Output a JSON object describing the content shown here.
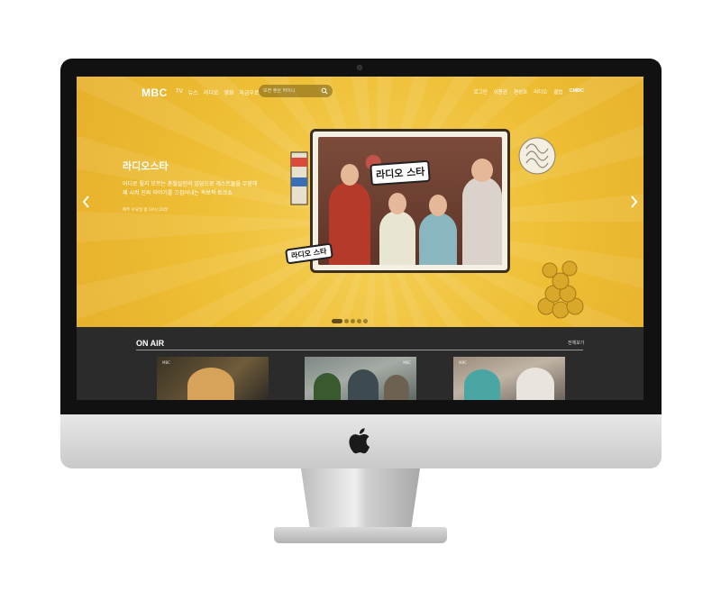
{
  "header": {
    "logo": "MBC",
    "nav": [
      "TV",
      "뉴스",
      "라디오",
      "영화",
      "자금우로"
    ],
    "search_placeholder": "보면 좋은 하이니",
    "util": [
      "로그인",
      "이용권",
      "편성표",
      "라디오",
      "클립"
    ],
    "util_brand": "CMBC"
  },
  "hero": {
    "title": "라디오스타",
    "description": "어디로 튈지 모르는 촌철살인의 입담으로 게스트들을 무장해제 시켜 진짜 이야기를 끄집어내는 독보적 토크쇼",
    "airtime": "매주 수요일 밤 10시 20분",
    "show_logo": "라디오 스타",
    "badge": "라디오 스타",
    "slides": 5,
    "active_slide": 1
  },
  "onair": {
    "title": "ON AIR",
    "more": "전체보기",
    "thumb_tags": [
      "MBC",
      "MBC",
      "MBC"
    ]
  },
  "colors": {
    "hero_yellow": "#f0c23a",
    "onair_bg": "#2b2b2b"
  }
}
